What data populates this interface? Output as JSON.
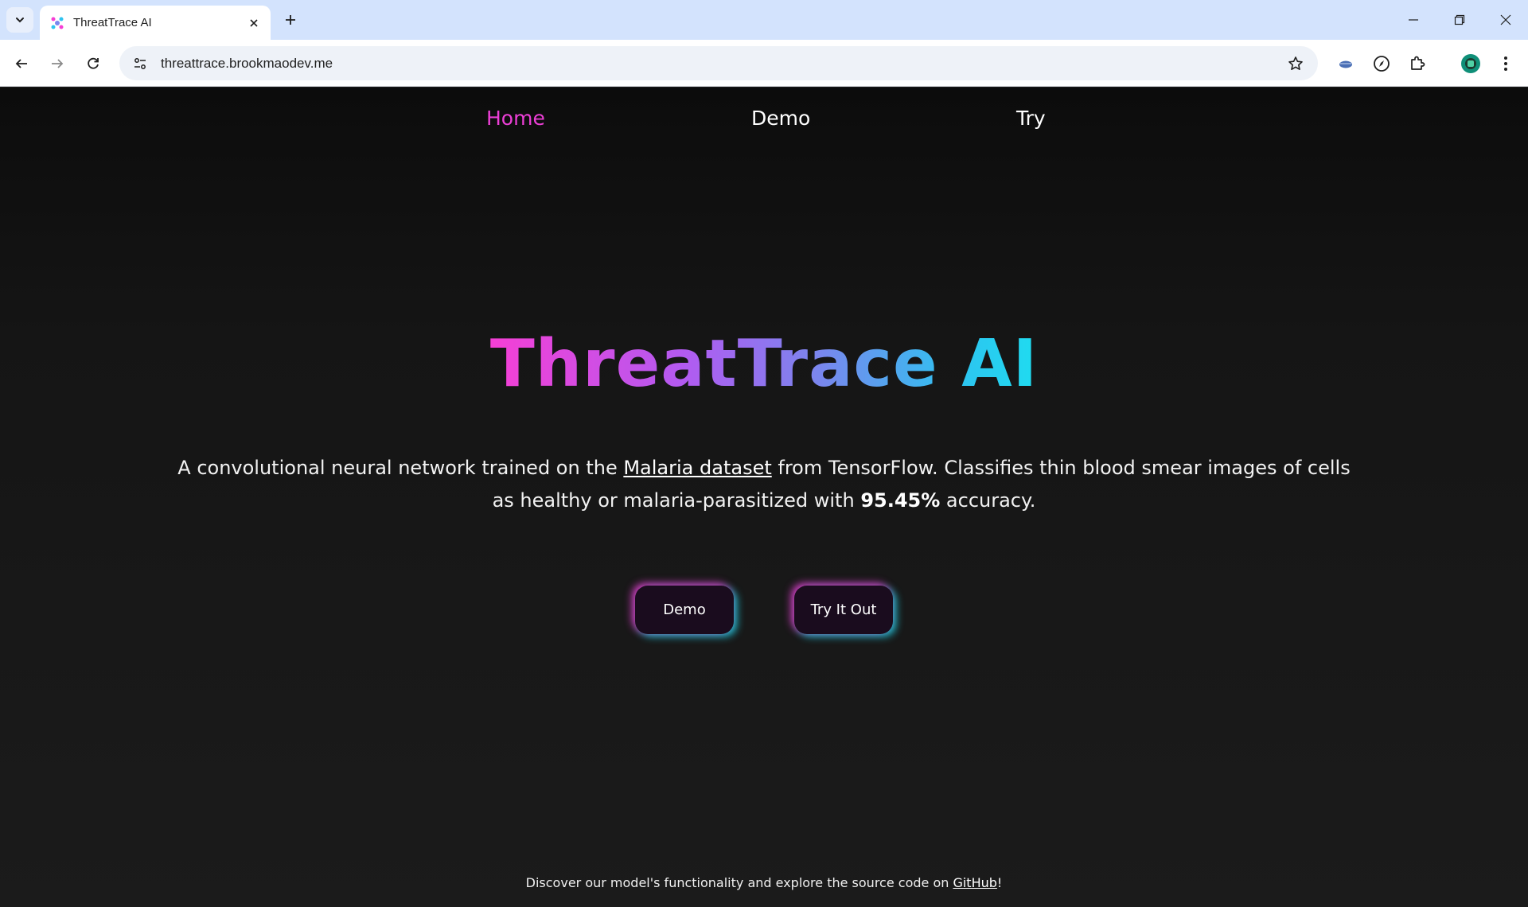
{
  "browser": {
    "tab_title": "ThreatTrace AI",
    "url": "threattrace.brookmaodev.me",
    "icons": {
      "tab_list": "chevron-down-icon",
      "tab_close": "close-icon",
      "new_tab": "plus-icon",
      "minimize": "minimize-icon",
      "restore": "restore-icon",
      "close_window": "close-icon",
      "back": "back-arrow-icon",
      "forward": "forward-arrow-icon",
      "reload": "reload-icon",
      "site_info": "site-settings-icon",
      "bookmark": "star-icon",
      "extensions": "puzzle-icon",
      "menu": "kebab-menu-icon"
    }
  },
  "nav": {
    "items": [
      {
        "label": "Home",
        "active": true
      },
      {
        "label": "Demo",
        "active": false
      },
      {
        "label": "Try",
        "active": false
      }
    ]
  },
  "hero": {
    "title": "ThreatTrace AI",
    "desc_before": "A convolutional neural network trained on the ",
    "desc_link": "Malaria dataset",
    "desc_middle": " from TensorFlow. Classifies thin blood smear images of cells as healthy or malaria-parasitized with ",
    "desc_accuracy": "95.45%",
    "desc_after": " accuracy."
  },
  "buttons": {
    "demo_label": "Demo",
    "try_label": "Try It Out"
  },
  "footer": {
    "text_before": "Discover our model's functionality and explore the source code on ",
    "link": "GitHub",
    "text_after": "!"
  },
  "colors": {
    "accent_pink": "#ec3fd6",
    "accent_cyan": "#1fdcf0",
    "tabbar": "#d3e3fd"
  }
}
